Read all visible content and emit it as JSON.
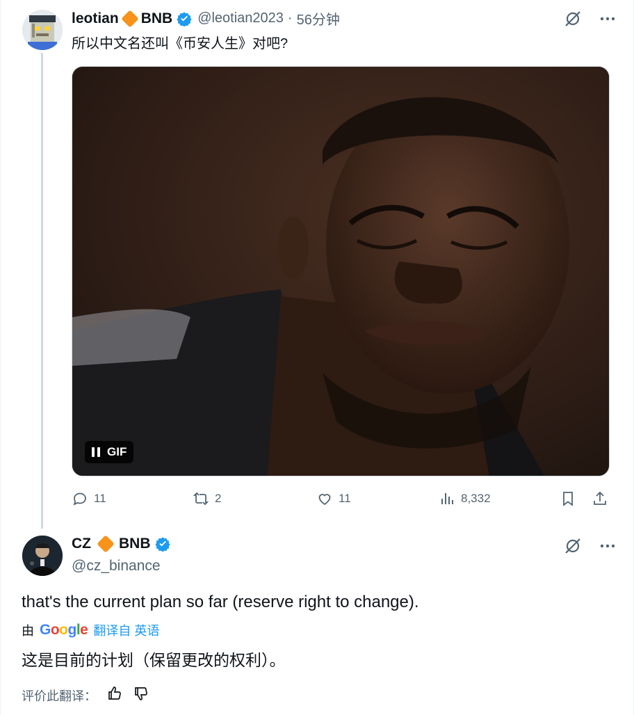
{
  "tweet1": {
    "name": "leotian",
    "name_suffix": "BNB",
    "handle": "@leotian2023",
    "separator": "·",
    "time": "56分钟",
    "text": "所以中文名还叫《币安人生》对吧?",
    "media": {
      "type": "gif",
      "badge_label": "GIF"
    },
    "actions": {
      "replies": "11",
      "reposts": "2",
      "likes": "11",
      "views": "8,332"
    }
  },
  "tweet2": {
    "name": "CZ",
    "name_suffix": "BNB",
    "handle": "@cz_binance",
    "text": "that's the current plan so far (reserve right to change).",
    "translation": {
      "by_label": "由",
      "provider": [
        "G",
        "o",
        "o",
        "g",
        "l",
        "e"
      ],
      "from_label": "翻译自 英语",
      "text": "这是目前的计划（保留更改的权利）。",
      "rate_label": "评价此翻译："
    }
  },
  "colors": {
    "verified": "#1d9bf0",
    "diamond": "#f7931a",
    "muted": "#536471",
    "text": "#0f1419"
  }
}
